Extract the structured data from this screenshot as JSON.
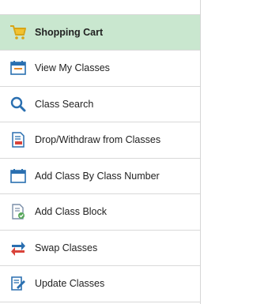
{
  "nav": {
    "items": [
      {
        "label": "Shopping Cart",
        "icon": "shopping-cart-icon",
        "selected": true
      },
      {
        "label": "View My Classes",
        "icon": "calendar-icon",
        "selected": false
      },
      {
        "label": "Class Search",
        "icon": "search-icon",
        "selected": false
      },
      {
        "label": "Drop/Withdraw from Classes",
        "icon": "drop-document-icon",
        "selected": false
      },
      {
        "label": "Add Class By Class Number",
        "icon": "calendar-add-icon",
        "selected": false
      },
      {
        "label": "Add Class Block",
        "icon": "document-check-icon",
        "selected": false
      },
      {
        "label": "Swap Classes",
        "icon": "swap-arrows-icon",
        "selected": false
      },
      {
        "label": "Update Classes",
        "icon": "edit-document-icon",
        "selected": false
      }
    ]
  },
  "colors": {
    "selected_bg": "#c9e7cf",
    "border": "#d9d9d9",
    "blue": "#2a6fb0",
    "red": "#d9433a",
    "green": "#57a85a"
  }
}
